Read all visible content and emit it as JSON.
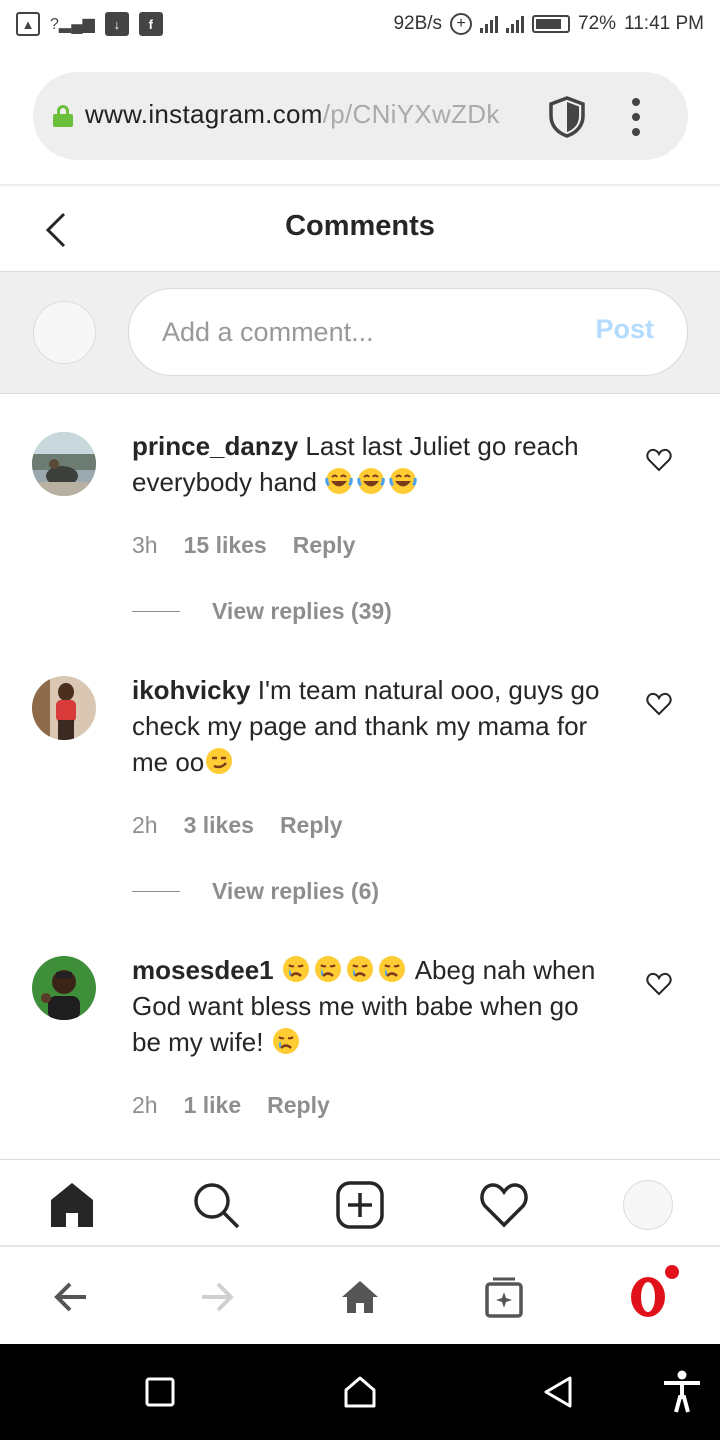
{
  "status_bar": {
    "speed": "92B/s",
    "battery": "72%",
    "time": "11:41 PM"
  },
  "browser": {
    "url_host": "www.instagram.com",
    "url_path": "/p/CNiYXwZDk"
  },
  "header": {
    "title": "Comments"
  },
  "composer": {
    "placeholder": "Add a comment...",
    "post_label": "Post"
  },
  "comments": [
    {
      "username": "prince_danzy",
      "text": "Last last Juliet go reach everybody hand",
      "emojis": [
        "laughing-tears",
        "laughing-tears",
        "laughing-tears"
      ],
      "time": "3h",
      "likes": "15 likes",
      "reply": "Reply",
      "replies": "View replies (39)"
    },
    {
      "username": "ikohvicky",
      "text": "I'm team natural ooo, guys go check my page and thank my mama for me oo",
      "emojis": [
        "smirk"
      ],
      "time": "2h",
      "likes": "3 likes",
      "reply": "Reply",
      "replies": "View replies (6)"
    },
    {
      "username": "mosesdee1",
      "emojis_lead": [
        "crying",
        "crying",
        "crying",
        "crying"
      ],
      "text": "Abeg nah when God want bless me with babe when go be my wife!",
      "emojis": [
        "crying"
      ],
      "time": "2h",
      "likes": "1 like",
      "reply": "Reply"
    }
  ],
  "colors": {
    "text": "#262626",
    "secondary": "#8e8e8e",
    "post_disabled": "#b3dbff",
    "opera_red": "#e0111a"
  }
}
